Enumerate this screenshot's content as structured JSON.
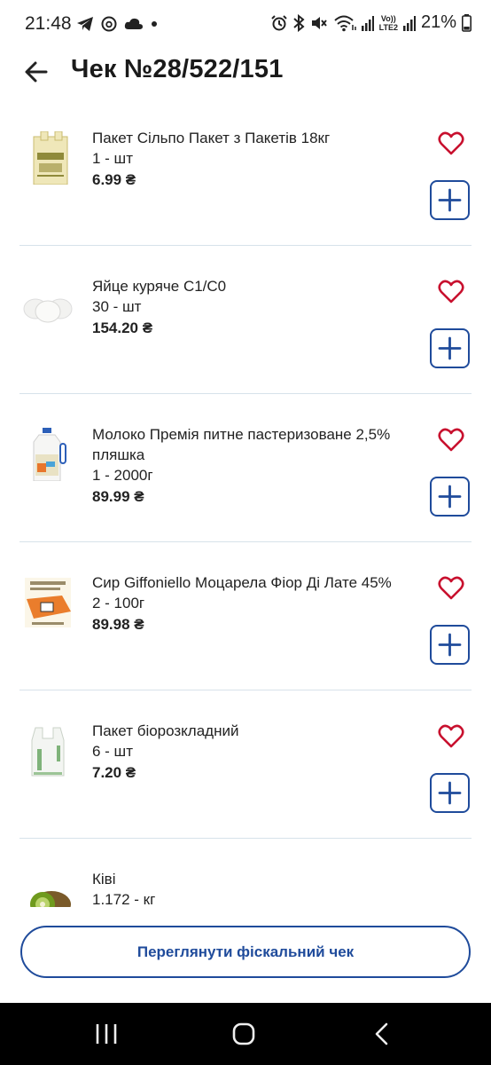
{
  "status_bar": {
    "time": "21:48",
    "battery": "21%",
    "left_icons": [
      "telegram-icon",
      "threads-icon",
      "cloud-icon",
      "dot-icon"
    ],
    "right_icons": [
      "alarm-icon",
      "bluetooth-icon",
      "mute-icon",
      "wifi-icon",
      "signal-icon",
      "volte-lte2-icon",
      "signal-icon",
      "battery-icon"
    ],
    "volte_text": "Vo))",
    "lte_text": "LTE2"
  },
  "header": {
    "title": "Чек №28/522/151",
    "back_icon": "arrow-left-icon"
  },
  "items": [
    {
      "name": "Пакет Сільпо Пакет з Пакетів 18кг",
      "qty": "1 - шт",
      "price": "6.99 ₴",
      "image": "bag-icon"
    },
    {
      "name": "Яйце куряче С1/С0",
      "qty": "30 - шт",
      "price": "154.20 ₴",
      "image": "eggs-icon"
    },
    {
      "name": "Молоко Премія питне пастеризоване 2,5% пляшка",
      "qty": "1 - 2000г",
      "price": "89.99 ₴",
      "image": "milk-bottle-icon"
    },
    {
      "name": "Сир Giffoniello Моцарела Фіор Ді Лате 45%",
      "qty": "2 - 100г",
      "price": "89.98 ₴",
      "image": "cheese-pack-icon"
    },
    {
      "name": "Пакет біорозкладний",
      "qty": "6 - шт",
      "price": "7.20 ₴",
      "image": "plastic-bag-icon"
    },
    {
      "name": "Ківі",
      "qty": "1.172 - кг",
      "price": "",
      "image": "kiwi-icon"
    }
  ],
  "actions": {
    "fiscal_button": "Переглянути фіскальний чек"
  },
  "colors": {
    "accent": "#1f4b9b",
    "heart": "#c8102e",
    "divider": "#d7e2ea"
  },
  "nav": [
    "recents-icon",
    "home-icon",
    "back-icon"
  ]
}
